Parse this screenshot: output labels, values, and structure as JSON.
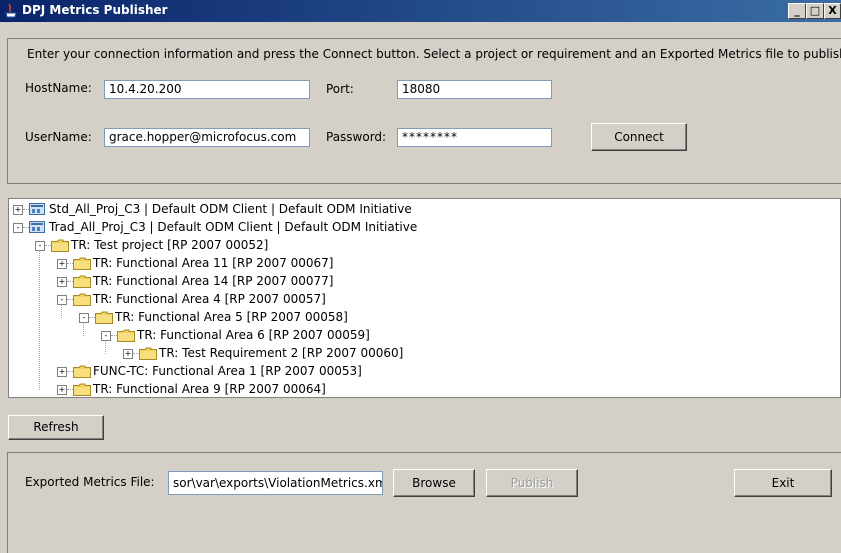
{
  "window": {
    "title": "DPJ Metrics Publisher"
  },
  "controls": {
    "minimize": "_",
    "maximize": "□",
    "close": "X"
  },
  "connection": {
    "instructions": "Enter your connection information and press the Connect button. Select a project or requirement and an Exported Metrics file to publish.",
    "hostname_label": "HostName:",
    "hostname_value": "10.4.20.200",
    "port_label": "Port:",
    "port_value": "18080",
    "username_label": "UserName:",
    "username_value": "grace.hopper@microfocus.com",
    "password_label": "Password:",
    "password_value": "********",
    "connect_label": "Connect"
  },
  "tree": {
    "nodes": [
      {
        "label": "Std_All_Proj_C3 | Default ODM Client | Default ODM Initiative",
        "icon": "project-icon",
        "expander": "+"
      },
      {
        "label": "Trad_All_Proj_C3 | Default ODM Client | Default ODM Initiative",
        "icon": "project-icon",
        "expander": "-"
      },
      {
        "label": "TR: Test project [RP 2007 00052]",
        "icon": "folder-icon",
        "expander": "-"
      },
      {
        "label": "TR: Functional Area 11 [RP 2007 00067]",
        "icon": "folder-icon",
        "expander": "+"
      },
      {
        "label": "TR: Functional Area 14 [RP 2007 00077]",
        "icon": "folder-icon",
        "expander": "+"
      },
      {
        "label": "TR: Functional Area 4 [RP 2007 00057]",
        "icon": "folder-icon",
        "expander": "-"
      },
      {
        "label": "TR: Functional Area 5 [RP 2007 00058]",
        "icon": "folder-icon",
        "expander": "-"
      },
      {
        "label": "TR: Functional Area 6 [RP 2007 00059]",
        "icon": "folder-icon",
        "expander": "-"
      },
      {
        "label": "TR: Test Requirement 2 [RP 2007 00060]",
        "icon": "folder-icon",
        "expander": "+"
      },
      {
        "label": "FUNC-TC: Functional Area 1 [RP 2007 00053]",
        "icon": "folder-icon",
        "expander": "+"
      },
      {
        "label": "TR: Functional Area 9 [RP 2007 00064]",
        "icon": "folder-icon",
        "expander": "+"
      }
    ],
    "refresh_label": "Refresh"
  },
  "publish": {
    "file_label": "Exported Metrics File:",
    "file_value": "sor\\var\\exports\\ViolationMetrics.xml",
    "browse_label": "Browse",
    "publish_label": "Publish",
    "exit_label": "Exit"
  },
  "colors": {
    "titlebar": "#0a246a",
    "folder": "#f2d25e",
    "window": "#d4d0c8"
  }
}
